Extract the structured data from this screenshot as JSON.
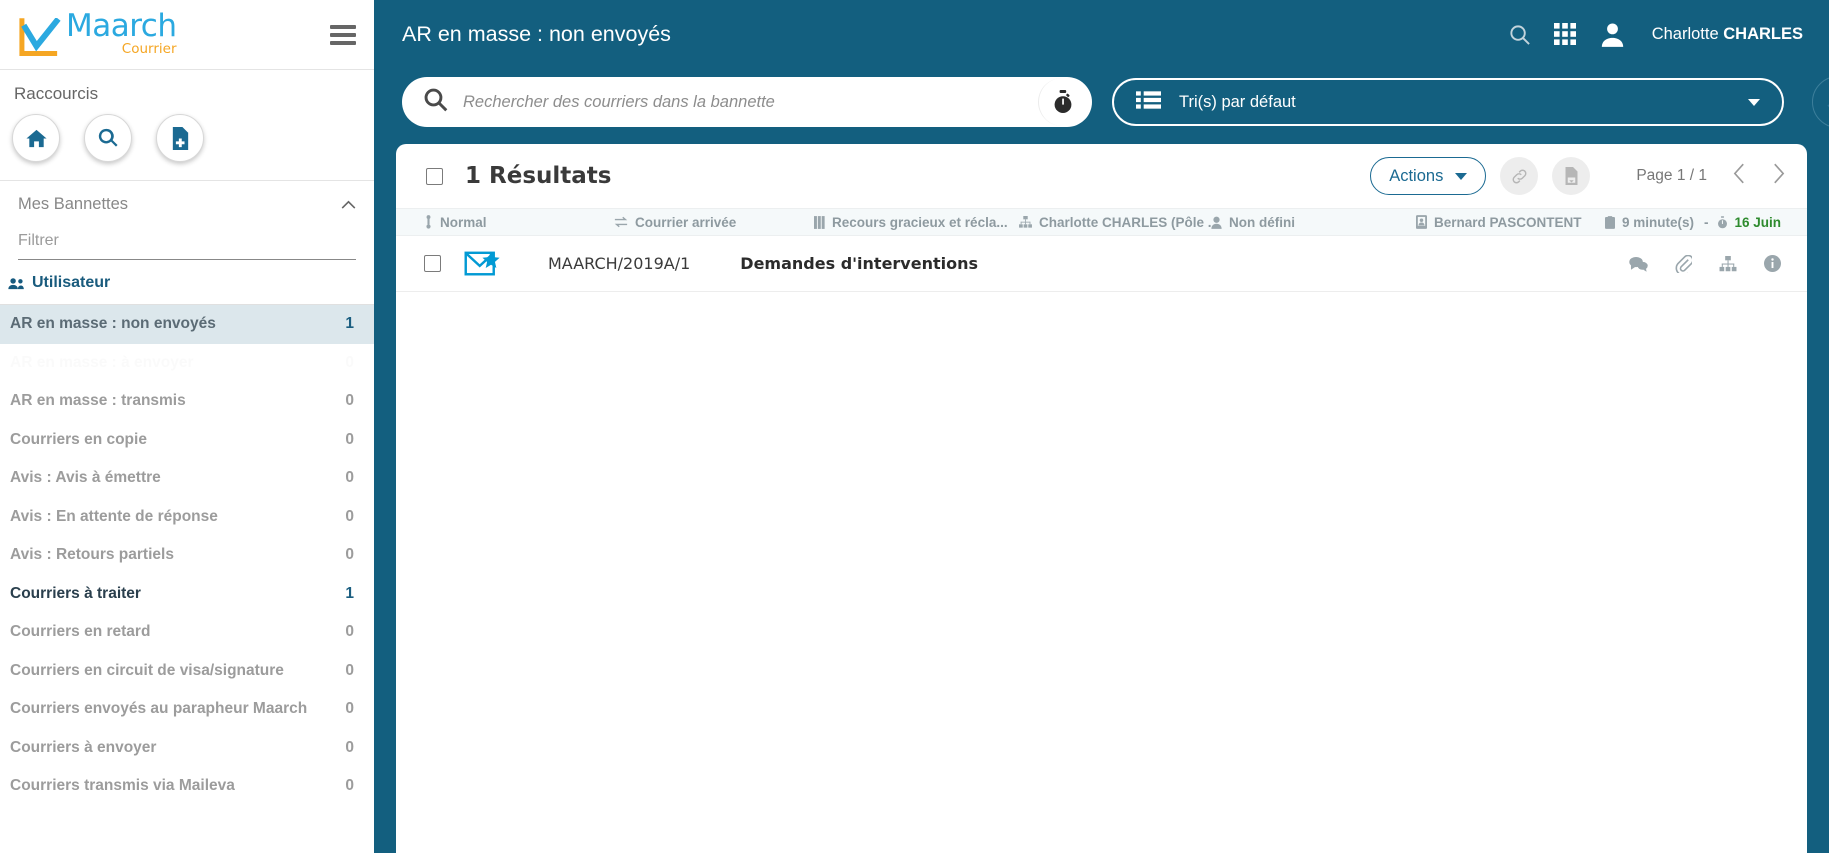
{
  "brand": {
    "name": "Maarch",
    "subtitle": "Courrier",
    "primary_color": "#135f7f",
    "logo_blue": "#2ba9e0",
    "logo_orange": "#f5a623"
  },
  "sidebar": {
    "menu_icon": "hamburger-icon",
    "shortcuts": {
      "label": "Raccourcis",
      "items": [
        {
          "name": "home-icon",
          "title": "Accueil"
        },
        {
          "name": "search-icon",
          "title": "Recherche"
        },
        {
          "name": "new-document-icon",
          "title": "Nouveau courrier"
        }
      ]
    },
    "bannettes": {
      "title": "Mes Bannettes",
      "collapse_icon": "chevron-up-icon",
      "filter_placeholder": "Filtrer",
      "filter_value": "",
      "group": {
        "icon": "users-icon",
        "label": "Utilisateur"
      },
      "items": [
        {
          "label": "AR en masse : non envoyés",
          "count": "1",
          "state": "selected"
        },
        {
          "label": "AR en masse : à envoyer",
          "count": "0",
          "state": "ghost"
        },
        {
          "label": "AR en masse : transmis",
          "count": "0",
          "state": "normal"
        },
        {
          "label": "Courriers en copie",
          "count": "0",
          "state": "normal"
        },
        {
          "label": "Avis : Avis à émettre",
          "count": "0",
          "state": "normal"
        },
        {
          "label": "Avis : En attente de réponse",
          "count": "0",
          "state": "normal"
        },
        {
          "label": "Avis : Retours partiels",
          "count": "0",
          "state": "normal"
        },
        {
          "label": "Courriers à traiter",
          "count": "1",
          "state": "active"
        },
        {
          "label": "Courriers en retard",
          "count": "0",
          "state": "normal"
        },
        {
          "label": "Courriers en circuit de visa/signature",
          "count": "0",
          "state": "normal"
        },
        {
          "label": "Courriers envoyés au parapheur Maarch",
          "count": "0",
          "state": "normal"
        },
        {
          "label": "Courriers à envoyer",
          "count": "0",
          "state": "normal"
        },
        {
          "label": "Courriers transmis via Maileva",
          "count": "0",
          "state": "normal"
        }
      ]
    }
  },
  "header": {
    "title": "AR en masse : non envoyés",
    "search_icon": "search-icon",
    "apps_icon": "grid-apps-icon",
    "avatar_icon": "user-avatar-icon",
    "user_first_name": "Charlotte ",
    "user_last_name": "CHARLES"
  },
  "search": {
    "icon": "search-icon",
    "placeholder": "Rechercher des courriers dans la bannette",
    "value": "",
    "stopwatch_icon": "stopwatch-icon"
  },
  "sort": {
    "icon": "list-icon",
    "label": "Tri(s) par défaut",
    "caret_icon": "chevron-down-icon",
    "direction_icon": "sort-descending-icon"
  },
  "results": {
    "select_all_checkbox": "unchecked",
    "count_label": "1 Résultats",
    "actions_label": "Actions",
    "actions_caret": "chevron-down-icon",
    "link_icon": "link-icon",
    "export-icon": "document-export-icon",
    "page_label": "Page 1 / 1",
    "prev_icon": "chevron-left-icon",
    "next_icon": "chevron-right-icon"
  },
  "columns": [
    {
      "icon": "priority-icon",
      "label": "Normal"
    },
    {
      "icon": "exchange-icon",
      "label": "Courrier arrivée"
    },
    {
      "icon": "archive-icon",
      "label": "Recours gracieux et récla..."
    },
    {
      "icon": "sitemap-icon",
      "label": "Charlotte CHARLES (Pôle ..."
    },
    {
      "icon": "user-icon",
      "label": "Non défini"
    },
    {
      "icon": "id-card-icon",
      "label": "Bernard PASCONTENT"
    }
  ],
  "column_date": {
    "clipboard_icon": "clipboard-icon",
    "process_delay": "9 minute(s)",
    "separator": "-",
    "stopwatch_icon": "stopwatch-icon",
    "date": "16 Juin",
    "date_color": "#2e8b2e"
  },
  "rows": [
    {
      "checkbox": "unchecked",
      "mail_icon": "mail-new-icon",
      "chrono": "MAARCH/2019A/1",
      "subject": "Demandes d'interventions",
      "actions": [
        {
          "name": "comments-icon"
        },
        {
          "name": "attachment-icon"
        },
        {
          "name": "sitemap-icon"
        },
        {
          "name": "info-icon"
        }
      ]
    }
  ]
}
